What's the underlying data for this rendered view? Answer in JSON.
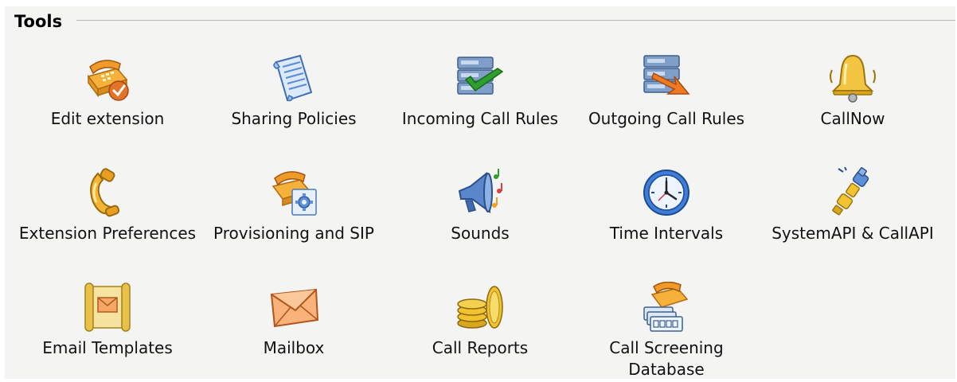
{
  "section": {
    "title": "Tools"
  },
  "tools": [
    {
      "label": "Edit extension",
      "icon": "edit-extension-icon"
    },
    {
      "label": "Sharing Policies",
      "icon": "sharing-policies-icon"
    },
    {
      "label": "Incoming Call Rules",
      "icon": "incoming-call-rules-icon"
    },
    {
      "label": "Outgoing Call Rules",
      "icon": "outgoing-call-rules-icon"
    },
    {
      "label": "CallNow",
      "icon": "callnow-bell-icon"
    },
    {
      "label": "Extension Preferences",
      "icon": "extension-preferences-icon"
    },
    {
      "label": "Provisioning and SIP",
      "icon": "provisioning-sip-icon"
    },
    {
      "label": "Sounds",
      "icon": "sounds-icon"
    },
    {
      "label": "Time Intervals",
      "icon": "time-intervals-icon"
    },
    {
      "label": "SystemAPI & CallAPI",
      "icon": "system-api-icon"
    },
    {
      "label": "Email Templates",
      "icon": "email-templates-icon"
    },
    {
      "label": "Mailbox",
      "icon": "mailbox-icon"
    },
    {
      "label": "Call Reports",
      "icon": "call-reports-icon"
    },
    {
      "label": "Call Screening Database",
      "icon": "call-screening-database-icon"
    }
  ]
}
